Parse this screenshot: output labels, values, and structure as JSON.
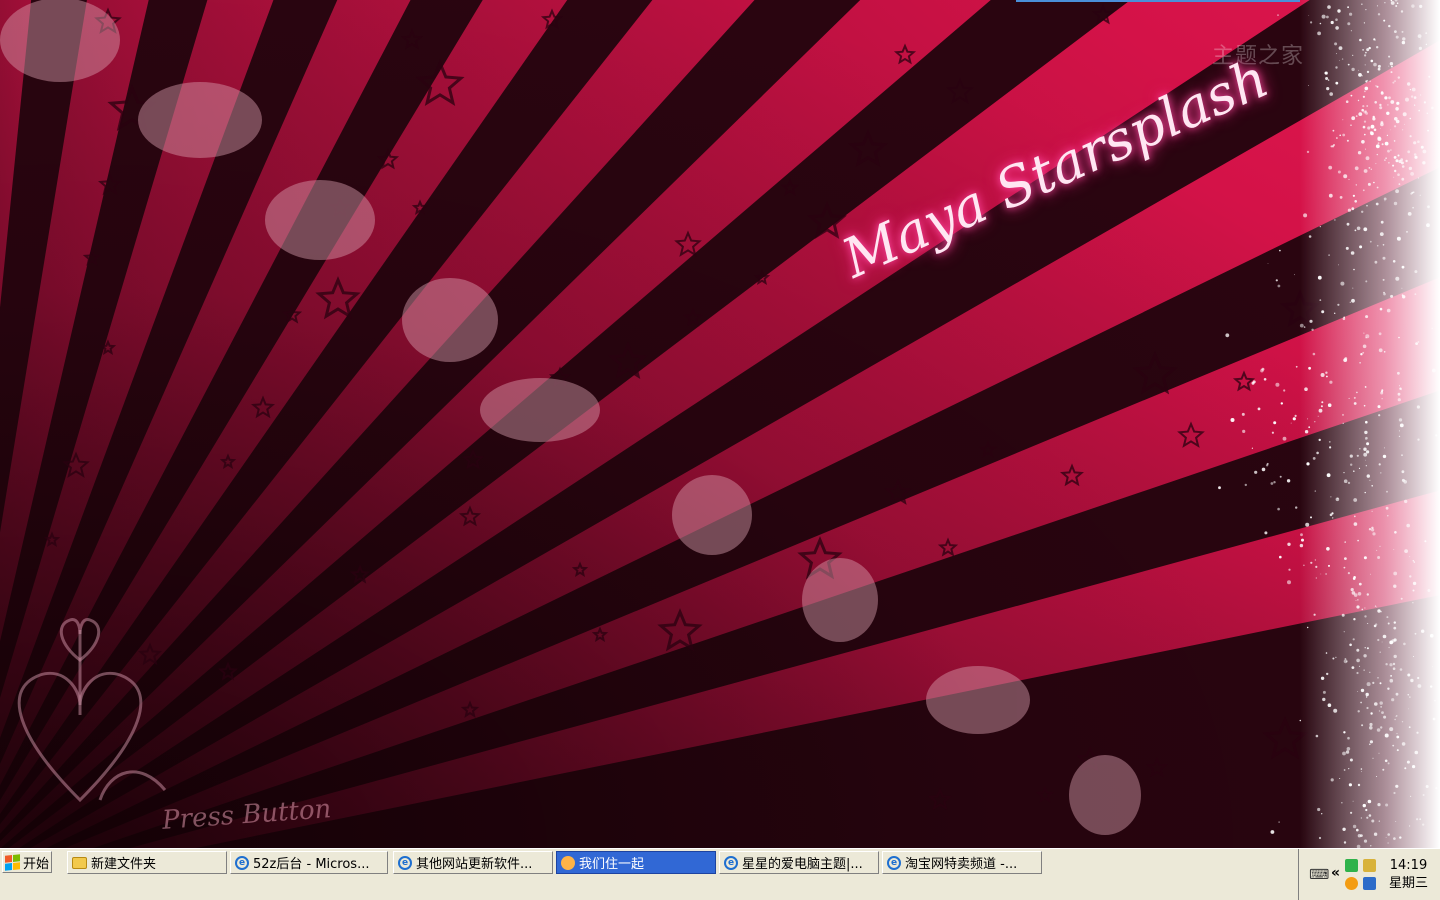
{
  "desktop": {
    "watermark": "主题之家",
    "signature": "Maya Starsplash",
    "corner_text": "Press Button"
  },
  "taskbar": {
    "start_label": "开始",
    "tasks": [
      {
        "label": "新建文件夹",
        "icon": "folder-icon",
        "active": false
      },
      {
        "label": "52z后台 - Micros...",
        "icon": "ie-icon",
        "active": false
      },
      {
        "label": "其他网站更新软件...",
        "icon": "ie-icon",
        "active": false
      },
      {
        "label": "我们住一起",
        "icon": "qq-icon",
        "active": true
      },
      {
        "label": "星星的爱电脑主题|...",
        "icon": "ie-icon",
        "active": false
      },
      {
        "label": "淘宝网特卖频道 -...",
        "icon": "ie-icon",
        "active": false
      }
    ],
    "tray": {
      "expand_glyph": "«",
      "time": "14:19",
      "day": "星期三"
    }
  },
  "colors": {
    "taskbar_bg": "#ece9d8",
    "active_task": "#3168d5",
    "ray_pink": "#e8154f",
    "ray_dark": "#2c0410"
  }
}
